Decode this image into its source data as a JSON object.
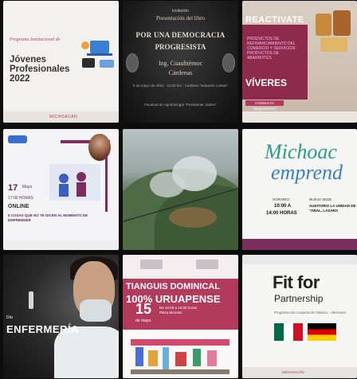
{
  "tiles": [
    {
      "id": "jovenes",
      "subtitle": "Programa Institucional de",
      "title_lines": [
        "Jóvenes",
        "Profesionales",
        "2022"
      ],
      "footer": "MICHOACÁN"
    },
    {
      "id": "presentacion-libro",
      "line1": "Invitación",
      "line2": "Presentación del libro",
      "line3": "POR UNA DEMOCRACIA",
      "line4": "PROGRESISTA",
      "line5": "Ing. Cuauhtémoc",
      "line6": "Cárdenas",
      "details": "6 de mayo de 2022 · 11:00 hrs · Auditorio \"Eduardo Lobato\"",
      "footer": "Facultad de Agrobiología \"Presidente Juárez\""
    },
    {
      "id": "reactivate",
      "heading": "REACTIVATE",
      "body": "PRODUCTOS DE REFINANCIAMIENTO DEL COMERCIO Y SERVICIOS · PRODUCTOS DE ABARROTES",
      "viveres": "VÍVERES",
      "button": "CONSULTA REQUISITOS"
    },
    {
      "id": "emprendedor-online",
      "fecha": "17",
      "mes": "Mayo",
      "hora": "17:00 HORAS",
      "modalidad": "ONLINE",
      "descripcion": "5 COSAS QUE NO TE DICEN AL MOMENTO DE EMPRENDER"
    },
    {
      "id": "forest-photo"
    },
    {
      "id": "michoacan-emprende",
      "logo_top": "Michoac",
      "logo_bottom": "emprend",
      "col1_label": "HORARIO:",
      "col1_value1": "10:00 A",
      "col1_value2": "14:00 HORAS",
      "col2_label": "NUEVA SEDE",
      "col2_value": "AUDITORIO LA UNIDAD DE \"GRAL. LÁZARO"
    },
    {
      "id": "enfermeria",
      "small": "Día",
      "big": "ENFERMERÍA"
    },
    {
      "id": "tianguis",
      "line1": "TIANGUIS DOMINICAL",
      "line2": "100% URUAPENSE",
      "fecha": "15",
      "mes": "de mayo",
      "info": "De 10:00 a 15:00 horas · Plaza Morelos"
    },
    {
      "id": "fit-partnership",
      "fit": "Fit for",
      "partnership": "Partnership",
      "small": "Programa de cooperación México - Alemania",
      "footer": "MICHOACÁN"
    }
  ],
  "colors": {
    "brand_wine": "#7b2e5e",
    "brand_rose": "#b13a5d",
    "background": "#0d0d0d"
  }
}
